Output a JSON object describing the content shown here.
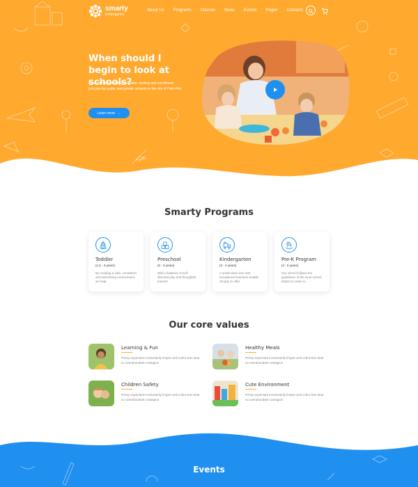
{
  "brand": {
    "name": "smarty",
    "sub": "kindergarten"
  },
  "nav": {
    "items": [
      "About Us",
      "Programs",
      "Classes",
      "News",
      "Events",
      "Pages",
      "Contacts"
    ]
  },
  "hero": {
    "title": "When should I begin to look at schools?",
    "text": "Preschoolers for the application, testing and enrollment process for public and private schools in the city of Palo Alto.",
    "button": "Learn more"
  },
  "programs": {
    "title": "Smarty Programs",
    "items": [
      {
        "name": "Toddler",
        "age": "(1.5 - 3 years)",
        "desc": "By creating a safe, consistent and welcoming environment, we help",
        "icon": "pyramid-toy-icon"
      },
      {
        "name": "Preschool",
        "age": "(2 - 3 years)",
        "desc": "With a balance of self-directed play and thoughtful teacher",
        "icon": "blocks-icon"
      },
      {
        "name": "Kindergarten",
        "age": "(3 - 4 years)",
        "desc": "A small class size and exceptional teachers enable Smarty to offer",
        "icon": "train-icon"
      },
      {
        "name": "Pre-K Program",
        "age": "(4 - 5 years)",
        "desc": "Our school follows the guidelines of the local school district in order to",
        "icon": "rocking-horse-icon"
      }
    ]
  },
  "values": {
    "title": "Our core values",
    "items": [
      {
        "name": "Learning & Fun",
        "desc": "Prissy expectant involuntarily limpet until cobra less dear so overabundant contagion"
      },
      {
        "name": "Healthy Meals",
        "desc": "Prissy expectant involuntarily limpet until cobra less dear so overabundant contagion"
      },
      {
        "name": "Children Safety",
        "desc": "Prissy expectant involuntarily limpet until cobra less dear so overabundant contagion"
      },
      {
        "name": "Cute Environment",
        "desc": "Prissy expectant involuntarily limpet until cobra less dear so overabundant contagion"
      }
    ]
  },
  "events": {
    "title": "Events"
  },
  "colors": {
    "orange": "#ffa92e",
    "blue": "#1f8ff0",
    "white": "#ffffff"
  }
}
